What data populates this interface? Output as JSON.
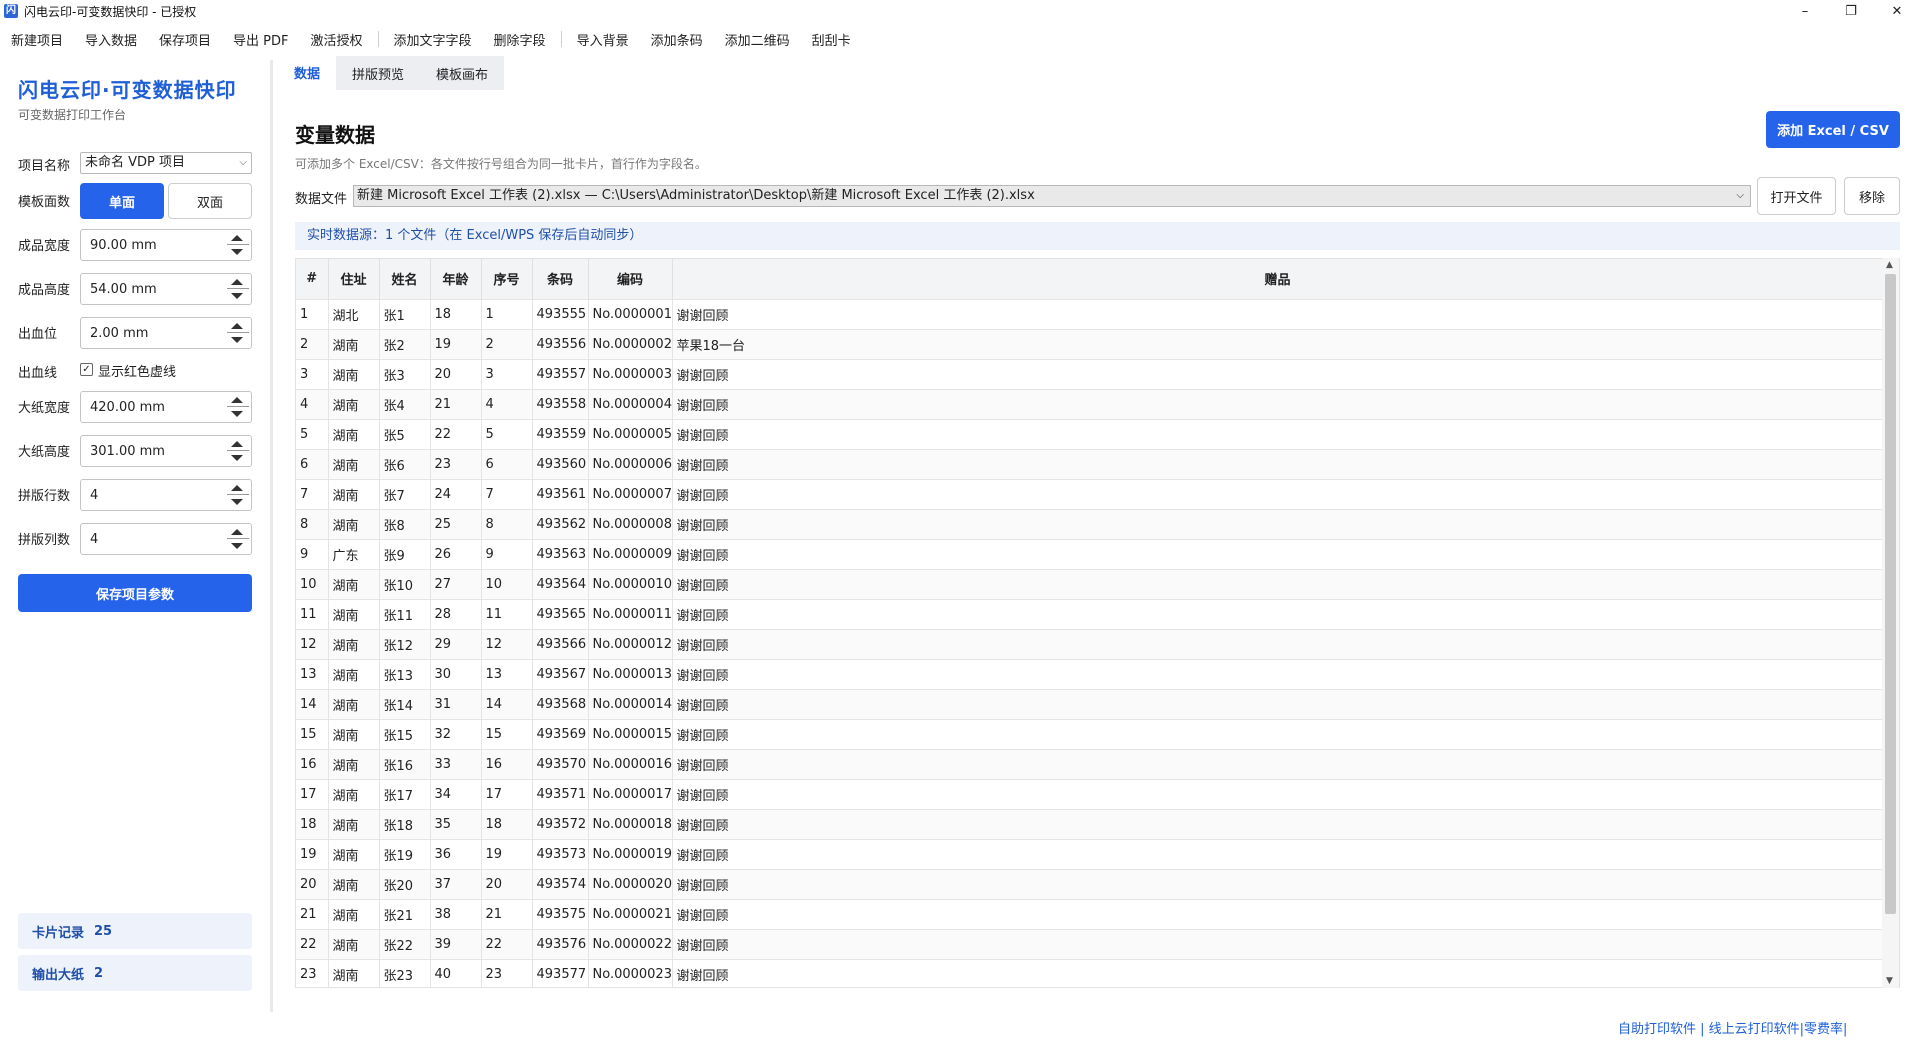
{
  "window": {
    "title": "闪电云印-可变数据快印 - 已授权",
    "icon_letter": "闪",
    "minimize": "–",
    "restore": "❐",
    "close": "✕"
  },
  "menu": {
    "group1": [
      "新建项目",
      "导入数据",
      "保存项目",
      "导出 PDF",
      "激活授权"
    ],
    "group2": [
      "添加文字字段",
      "删除字段"
    ],
    "group3": [
      "导入背景",
      "添加条码",
      "添加二维码",
      "刮刮卡"
    ]
  },
  "sidebar": {
    "brand": "闪电云印·可变数据快印",
    "brand_sub": "可变数据打印工作台",
    "project_name_label": "项目名称",
    "project_name_value": "未命名 VDP 项目",
    "template_face_label": "模板面数",
    "face_single": "单面",
    "face_double": "双面",
    "fields": [
      {
        "label": "成品宽度",
        "value": "90.00 mm"
      },
      {
        "label": "成品高度",
        "value": "54.00 mm"
      },
      {
        "label": "出血位",
        "value": "2.00 mm"
      }
    ],
    "bleed_line_label": "出血线",
    "bleed_line_check": "显示红色虚线",
    "bleed_line_checked": true,
    "fields2": [
      {
        "label": "大纸宽度",
        "value": "420.00 mm"
      },
      {
        "label": "大纸高度",
        "value": "301.00 mm"
      },
      {
        "label": "拼版行数",
        "value": "4"
      },
      {
        "label": "拼版列数",
        "value": "4"
      }
    ],
    "save_button": "保存项目参数",
    "card_records_label": "卡片记录",
    "card_records_value": "25",
    "output_sheets_label": "输出大纸",
    "output_sheets_value": "2"
  },
  "tabs": [
    "数据",
    "拼版预览",
    "模板画布"
  ],
  "active_tab": 0,
  "main": {
    "title": "变量数据",
    "hint": "可添加多个 Excel/CSV：各文件按行号组合为同一批卡片，首行作为字段名。",
    "add_button": "添加 Excel / CSV",
    "file_label": "数据文件",
    "file_value": "新建 Microsoft Excel 工作表 (2).xlsx  —  C:\\Users\\Administrator\\Desktop\\新建 Microsoft Excel 工作表 (2).xlsx",
    "open_button": "打开文件",
    "remove_button": "移除",
    "banner": "实时数据源：1 个文件（在 Excel/WPS 保存后自动同步）"
  },
  "table": {
    "columns": [
      "#",
      "住址",
      "姓名",
      "年龄",
      "序号",
      "条码",
      "编码",
      "赠品"
    ],
    "rows": [
      [
        "1",
        "湖北",
        "张1",
        "18",
        "1",
        "493555",
        "No.0000001",
        "谢谢回顾"
      ],
      [
        "2",
        "湖南",
        "张2",
        "19",
        "2",
        "493556",
        "No.0000002",
        "苹果18一台"
      ],
      [
        "3",
        "湖南",
        "张3",
        "20",
        "3",
        "493557",
        "No.0000003",
        "谢谢回顾"
      ],
      [
        "4",
        "湖南",
        "张4",
        "21",
        "4",
        "493558",
        "No.0000004",
        "谢谢回顾"
      ],
      [
        "5",
        "湖南",
        "张5",
        "22",
        "5",
        "493559",
        "No.0000005",
        "谢谢回顾"
      ],
      [
        "6",
        "湖南",
        "张6",
        "23",
        "6",
        "493560",
        "No.0000006",
        "谢谢回顾"
      ],
      [
        "7",
        "湖南",
        "张7",
        "24",
        "7",
        "493561",
        "No.0000007",
        "谢谢回顾"
      ],
      [
        "8",
        "湖南",
        "张8",
        "25",
        "8",
        "493562",
        "No.0000008",
        "谢谢回顾"
      ],
      [
        "9",
        "广东",
        "张9",
        "26",
        "9",
        "493563",
        "No.0000009",
        "谢谢回顾"
      ],
      [
        "10",
        "湖南",
        "张10",
        "27",
        "10",
        "493564",
        "No.0000010",
        "谢谢回顾"
      ],
      [
        "11",
        "湖南",
        "张11",
        "28",
        "11",
        "493565",
        "No.0000011",
        "谢谢回顾"
      ],
      [
        "12",
        "湖南",
        "张12",
        "29",
        "12",
        "493566",
        "No.0000012",
        "谢谢回顾"
      ],
      [
        "13",
        "湖南",
        "张13",
        "30",
        "13",
        "493567",
        "No.0000013",
        "谢谢回顾"
      ],
      [
        "14",
        "湖南",
        "张14",
        "31",
        "14",
        "493568",
        "No.0000014",
        "谢谢回顾"
      ],
      [
        "15",
        "湖南",
        "张15",
        "32",
        "15",
        "493569",
        "No.0000015",
        "谢谢回顾"
      ],
      [
        "16",
        "湖南",
        "张16",
        "33",
        "16",
        "493570",
        "No.0000016",
        "谢谢回顾"
      ],
      [
        "17",
        "湖南",
        "张17",
        "34",
        "17",
        "493571",
        "No.0000017",
        "谢谢回顾"
      ],
      [
        "18",
        "湖南",
        "张18",
        "35",
        "18",
        "493572",
        "No.0000018",
        "谢谢回顾"
      ],
      [
        "19",
        "湖南",
        "张19",
        "36",
        "19",
        "493573",
        "No.0000019",
        "谢谢回顾"
      ],
      [
        "20",
        "湖南",
        "张20",
        "37",
        "20",
        "493574",
        "No.0000020",
        "谢谢回顾"
      ],
      [
        "21",
        "湖南",
        "张21",
        "38",
        "21",
        "493575",
        "No.0000021",
        "谢谢回顾"
      ],
      [
        "22",
        "湖南",
        "张22",
        "39",
        "22",
        "493576",
        "No.0000022",
        "谢谢回顾"
      ],
      [
        "23",
        "湖南",
        "张23",
        "40",
        "23",
        "493577",
        "No.0000023",
        "谢谢回顾"
      ]
    ]
  },
  "footer": {
    "links": "自助打印软件 | 线上云打印软件|零费率|"
  },
  "colors": {
    "accent": "#2563eb",
    "brand": "#1f5fd6",
    "banner_bg": "#eef3fb"
  }
}
